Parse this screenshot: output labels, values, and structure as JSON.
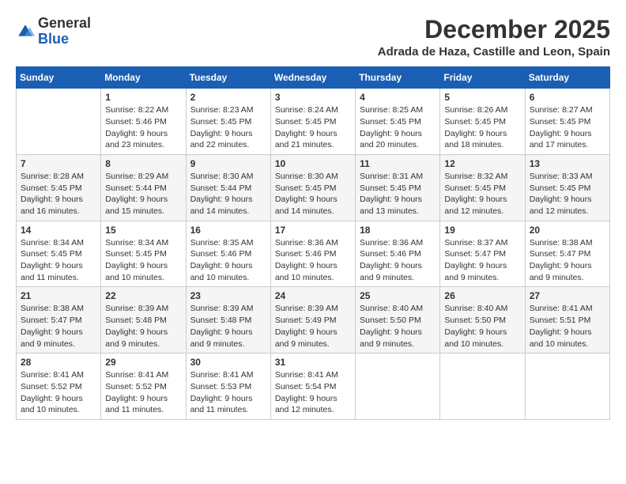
{
  "logo": {
    "general": "General",
    "blue": "Blue"
  },
  "title": "December 2025",
  "location": "Adrada de Haza, Castille and Leon, Spain",
  "days": [
    "Sunday",
    "Monday",
    "Tuesday",
    "Wednesday",
    "Thursday",
    "Friday",
    "Saturday"
  ],
  "weeks": [
    [
      {
        "day": "",
        "content": ""
      },
      {
        "day": "1",
        "content": "Sunrise: 8:22 AM\nSunset: 5:46 PM\nDaylight: 9 hours\nand 23 minutes."
      },
      {
        "day": "2",
        "content": "Sunrise: 8:23 AM\nSunset: 5:45 PM\nDaylight: 9 hours\nand 22 minutes."
      },
      {
        "day": "3",
        "content": "Sunrise: 8:24 AM\nSunset: 5:45 PM\nDaylight: 9 hours\nand 21 minutes."
      },
      {
        "day": "4",
        "content": "Sunrise: 8:25 AM\nSunset: 5:45 PM\nDaylight: 9 hours\nand 20 minutes."
      },
      {
        "day": "5",
        "content": "Sunrise: 8:26 AM\nSunset: 5:45 PM\nDaylight: 9 hours\nand 18 minutes."
      },
      {
        "day": "6",
        "content": "Sunrise: 8:27 AM\nSunset: 5:45 PM\nDaylight: 9 hours\nand 17 minutes."
      }
    ],
    [
      {
        "day": "7",
        "content": "Sunrise: 8:28 AM\nSunset: 5:45 PM\nDaylight: 9 hours\nand 16 minutes."
      },
      {
        "day": "8",
        "content": "Sunrise: 8:29 AM\nSunset: 5:44 PM\nDaylight: 9 hours\nand 15 minutes."
      },
      {
        "day": "9",
        "content": "Sunrise: 8:30 AM\nSunset: 5:44 PM\nDaylight: 9 hours\nand 14 minutes."
      },
      {
        "day": "10",
        "content": "Sunrise: 8:30 AM\nSunset: 5:45 PM\nDaylight: 9 hours\nand 14 minutes."
      },
      {
        "day": "11",
        "content": "Sunrise: 8:31 AM\nSunset: 5:45 PM\nDaylight: 9 hours\nand 13 minutes."
      },
      {
        "day": "12",
        "content": "Sunrise: 8:32 AM\nSunset: 5:45 PM\nDaylight: 9 hours\nand 12 minutes."
      },
      {
        "day": "13",
        "content": "Sunrise: 8:33 AM\nSunset: 5:45 PM\nDaylight: 9 hours\nand 12 minutes."
      }
    ],
    [
      {
        "day": "14",
        "content": "Sunrise: 8:34 AM\nSunset: 5:45 PM\nDaylight: 9 hours\nand 11 minutes."
      },
      {
        "day": "15",
        "content": "Sunrise: 8:34 AM\nSunset: 5:45 PM\nDaylight: 9 hours\nand 10 minutes."
      },
      {
        "day": "16",
        "content": "Sunrise: 8:35 AM\nSunset: 5:46 PM\nDaylight: 9 hours\nand 10 minutes."
      },
      {
        "day": "17",
        "content": "Sunrise: 8:36 AM\nSunset: 5:46 PM\nDaylight: 9 hours\nand 10 minutes."
      },
      {
        "day": "18",
        "content": "Sunrise: 8:36 AM\nSunset: 5:46 PM\nDaylight: 9 hours\nand 9 minutes."
      },
      {
        "day": "19",
        "content": "Sunrise: 8:37 AM\nSunset: 5:47 PM\nDaylight: 9 hours\nand 9 minutes."
      },
      {
        "day": "20",
        "content": "Sunrise: 8:38 AM\nSunset: 5:47 PM\nDaylight: 9 hours\nand 9 minutes."
      }
    ],
    [
      {
        "day": "21",
        "content": "Sunrise: 8:38 AM\nSunset: 5:47 PM\nDaylight: 9 hours\nand 9 minutes."
      },
      {
        "day": "22",
        "content": "Sunrise: 8:39 AM\nSunset: 5:48 PM\nDaylight: 9 hours\nand 9 minutes."
      },
      {
        "day": "23",
        "content": "Sunrise: 8:39 AM\nSunset: 5:48 PM\nDaylight: 9 hours\nand 9 minutes."
      },
      {
        "day": "24",
        "content": "Sunrise: 8:39 AM\nSunset: 5:49 PM\nDaylight: 9 hours\nand 9 minutes."
      },
      {
        "day": "25",
        "content": "Sunrise: 8:40 AM\nSunset: 5:50 PM\nDaylight: 9 hours\nand 9 minutes."
      },
      {
        "day": "26",
        "content": "Sunrise: 8:40 AM\nSunset: 5:50 PM\nDaylight: 9 hours\nand 10 minutes."
      },
      {
        "day": "27",
        "content": "Sunrise: 8:41 AM\nSunset: 5:51 PM\nDaylight: 9 hours\nand 10 minutes."
      }
    ],
    [
      {
        "day": "28",
        "content": "Sunrise: 8:41 AM\nSunset: 5:52 PM\nDaylight: 9 hours\nand 10 minutes."
      },
      {
        "day": "29",
        "content": "Sunrise: 8:41 AM\nSunset: 5:52 PM\nDaylight: 9 hours\nand 11 minutes."
      },
      {
        "day": "30",
        "content": "Sunrise: 8:41 AM\nSunset: 5:53 PM\nDaylight: 9 hours\nand 11 minutes."
      },
      {
        "day": "31",
        "content": "Sunrise: 8:41 AM\nSunset: 5:54 PM\nDaylight: 9 hours\nand 12 minutes."
      },
      {
        "day": "",
        "content": ""
      },
      {
        "day": "",
        "content": ""
      },
      {
        "day": "",
        "content": ""
      }
    ]
  ]
}
